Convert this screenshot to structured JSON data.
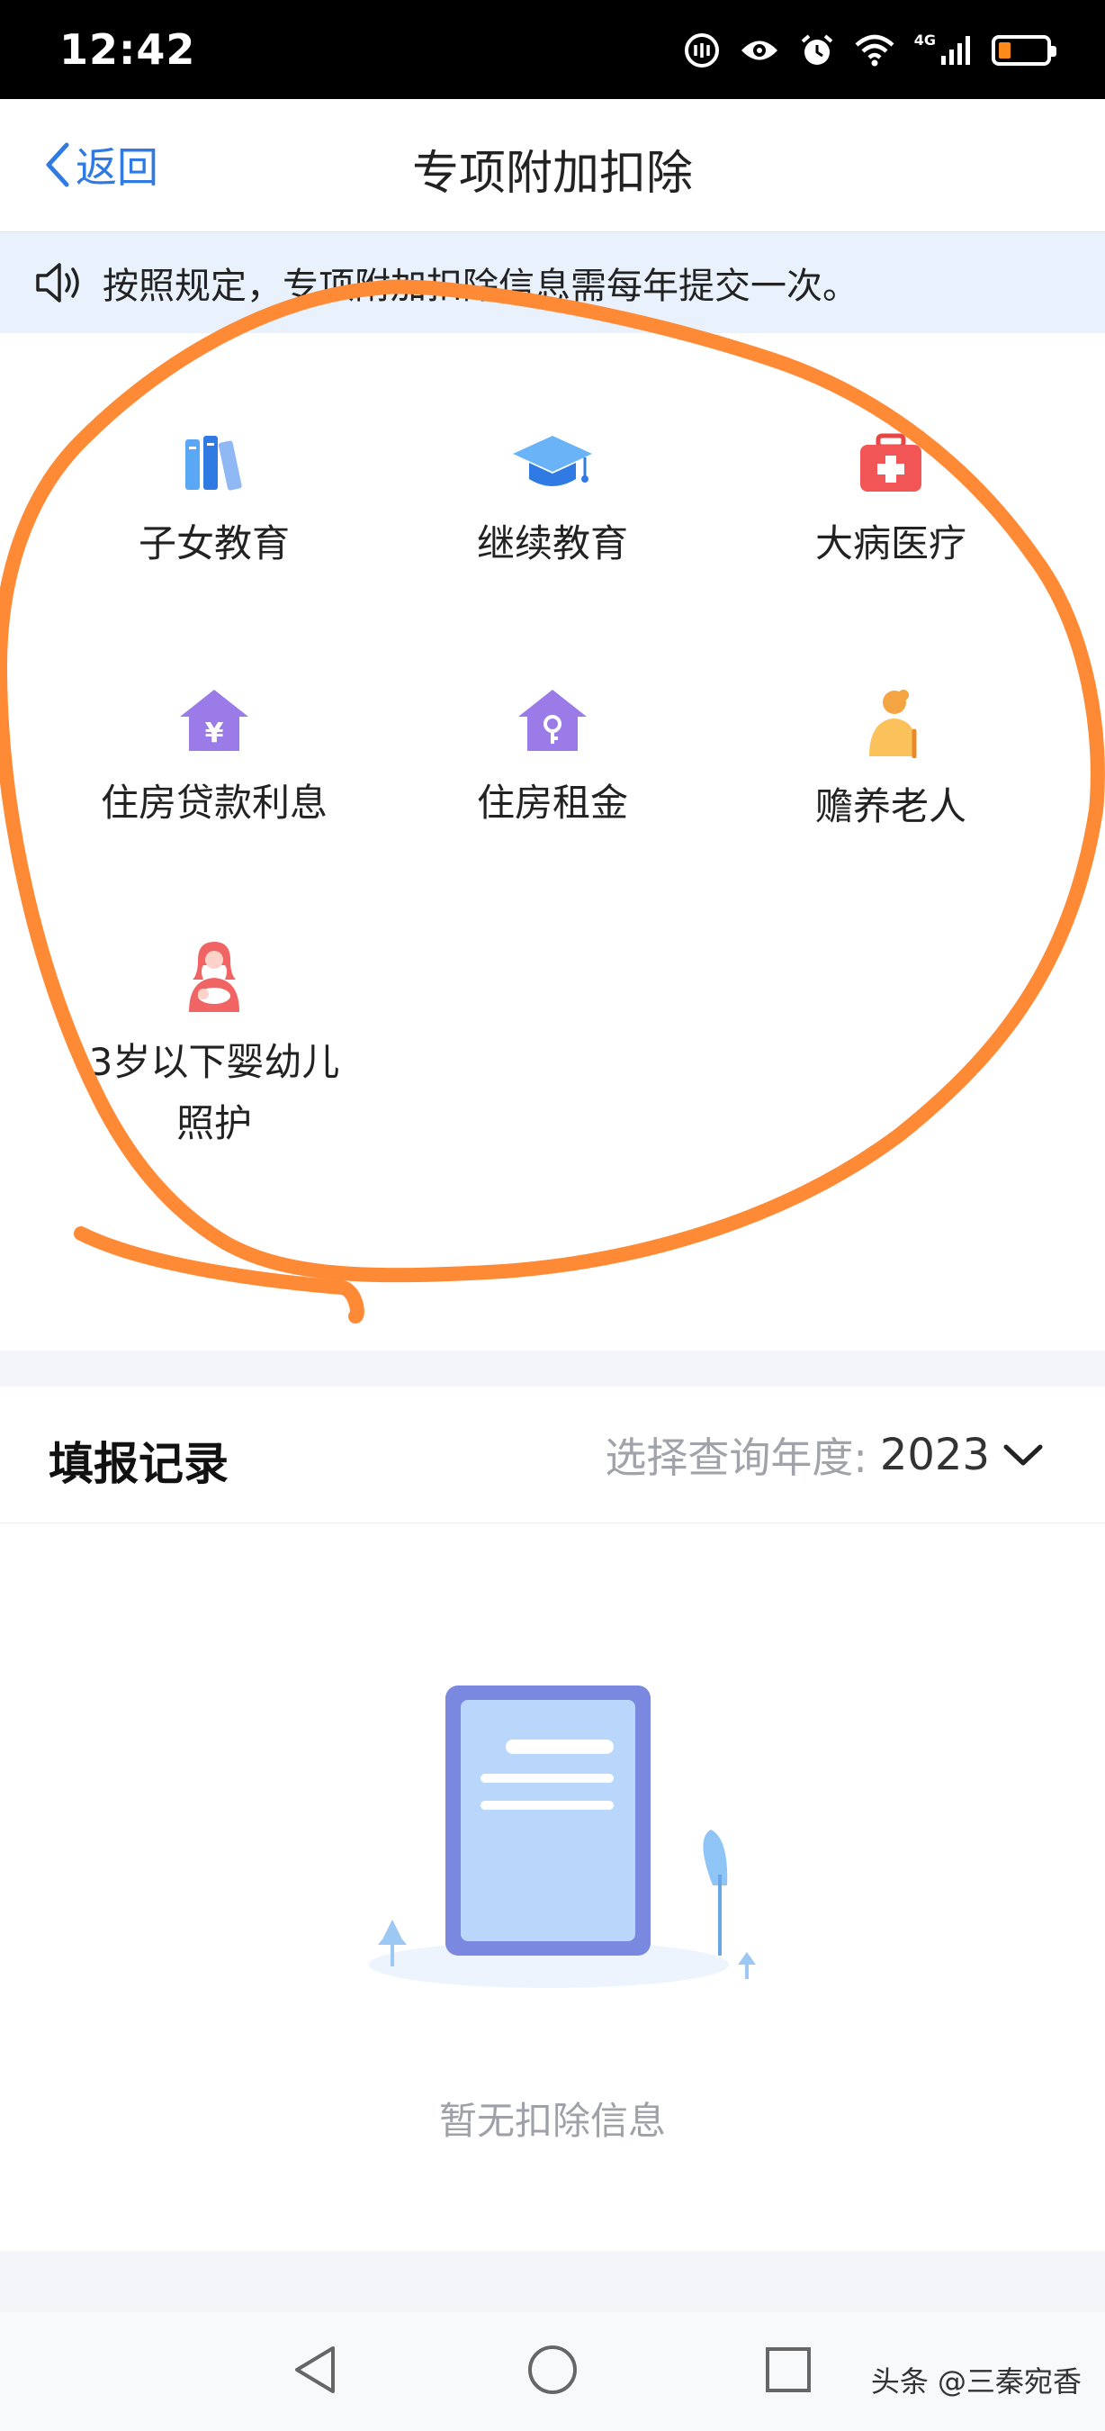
{
  "status_bar": {
    "time": "12:42",
    "network": "4G",
    "battery_level": 0.25,
    "icons": [
      "nfc-icon",
      "eye-icon",
      "alarm-icon",
      "wifi-icon",
      "signal-icon",
      "battery-icon"
    ]
  },
  "nav": {
    "back_label": "返回",
    "title": "专项附加扣除"
  },
  "notice": {
    "text": "按照规定，专项附加扣除信息需每年提交一次。",
    "icon": "speaker-icon"
  },
  "deductions": [
    {
      "label": "子女教育",
      "icon": "books-icon"
    },
    {
      "label": "继续教育",
      "icon": "graduation-cap-icon"
    },
    {
      "label": "大病医疗",
      "icon": "medical-kit-icon"
    },
    {
      "label": "住房贷款利息",
      "icon": "house-yen-icon"
    },
    {
      "label": "住房租金",
      "icon": "house-key-icon"
    },
    {
      "label": "赡养老人",
      "icon": "elderly-person-icon"
    },
    {
      "label": "3岁以下婴幼儿照护",
      "icon": "mother-baby-icon"
    }
  ],
  "records": {
    "title": "填报记录",
    "year_label": "选择查询年度:",
    "year_value": "2023",
    "empty_text": "暂无扣除信息"
  },
  "colors": {
    "accent_blue": "#2f7be3",
    "annotation_orange": "#ff8a35",
    "notice_bg": "#e9f2fc"
  },
  "watermark": "头条 @三秦宛香"
}
